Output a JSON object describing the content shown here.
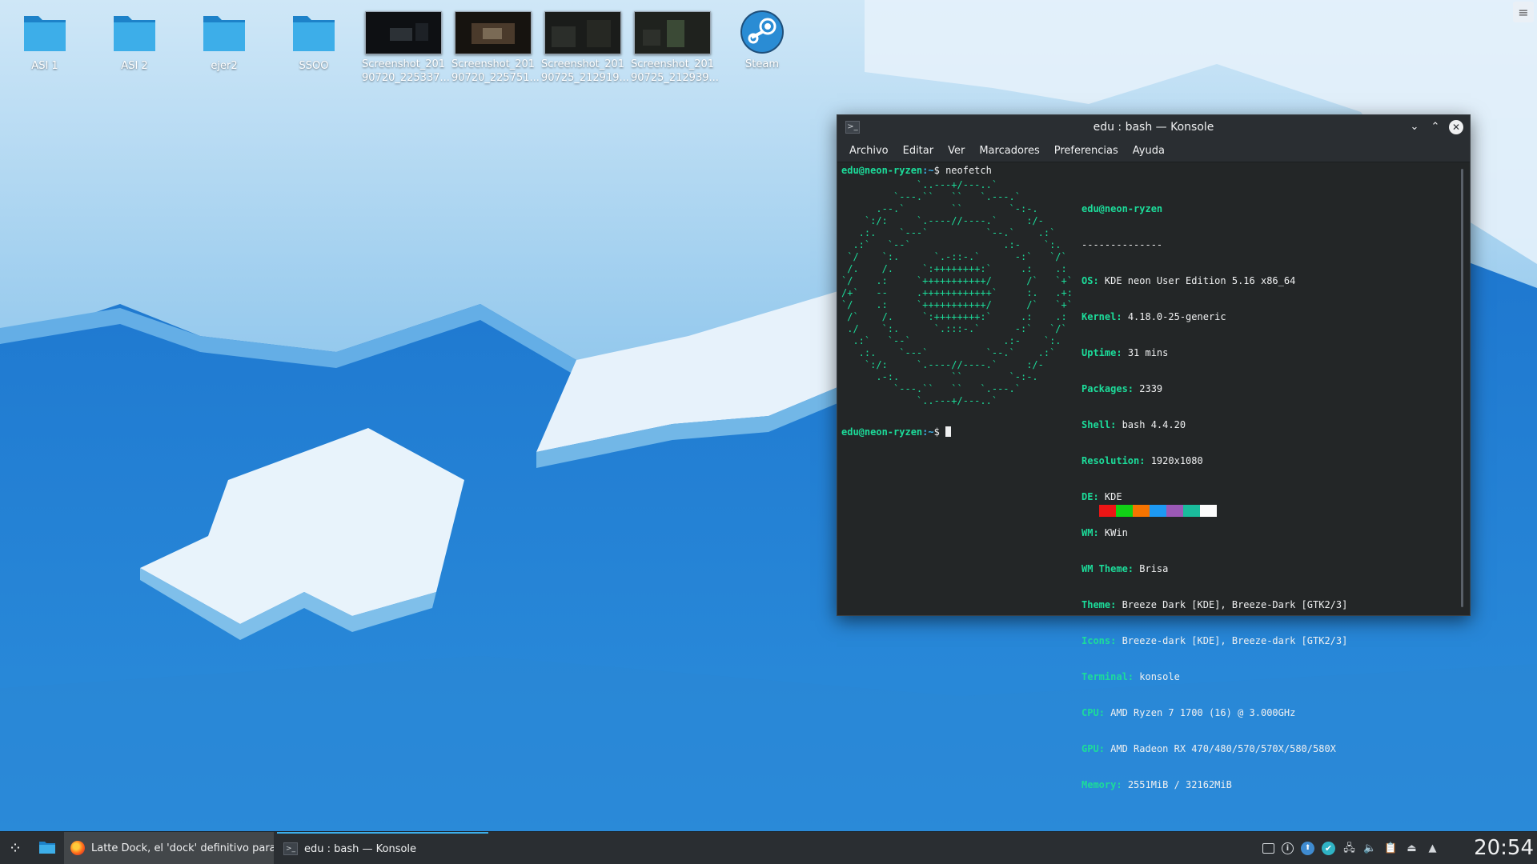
{
  "desktop": {
    "icons": [
      {
        "label": "ASI 1",
        "kind": "folder"
      },
      {
        "label": "ASI 2",
        "kind": "folder"
      },
      {
        "label": "ejer2",
        "kind": "folder"
      },
      {
        "label": "SSOO",
        "kind": "folder"
      },
      {
        "label": "Screenshot_201\n90720_225337...",
        "kind": "image"
      },
      {
        "label": "Screenshot_201\n90720_225751...",
        "kind": "image"
      },
      {
        "label": "Screenshot_201\n90725_212919...",
        "kind": "image"
      },
      {
        "label": "Screenshot_201\n90725_212939...",
        "kind": "image"
      },
      {
        "label": "Steam",
        "kind": "app"
      }
    ],
    "corner_menu_icon": "hamburger-icon",
    "corner_menu_glyph": "≡"
  },
  "konsole": {
    "title": "edu : bash — Konsole",
    "app_icon_glyph": ">_",
    "buttons": {
      "minimize": "⌄",
      "maximize": "⌃",
      "close": "✕"
    },
    "menu": [
      "Archivo",
      "Editar",
      "Ver",
      "Marcadores",
      "Preferencias",
      "Ayuda"
    ],
    "prompt_user": "edu@neon-ryzen",
    "prompt_path": ":~",
    "prompt_symbol": "$ ",
    "command": "neofetch",
    "ascii_art": "             `..---+/---..`\n         `---.``   ``   `.---.`\n      .--.`        ``        `-:-.\n    `:/:     `.----//----.`     :/-\n   .:.    `---`          `--.`    .:`\n  .:`   `--`                .:-    `:.\n `/    `:.      `.-::-.`      -:`   `/`\n /.    /.     `:++++++++:`     .:    .:\n`/    .:     `+++++++++++/      /`   `+`\n/+`   --     .++++++++++++`     :.   .+:\n`/    .:     `+++++++++++/      /`   `+`\n /`    /.     `:++++++++:`     .:    .:\n ./    `:.      `.:::-.`      -:`   `/`\n  .:`   `--`                .:-    `:.\n   .:.    `---`          `--.`    .:`\n    `:/:     `.----//----.`     :/-\n      .-:.         ``        `-:-.\n         `---.``   ``   `.---.`\n             `..---+/---..`",
    "info": {
      "host": "edu@neon-ryzen",
      "separator": "--------------",
      "rows": [
        {
          "key": "OS",
          "value": "KDE neon User Edition 5.16 x86_64"
        },
        {
          "key": "Kernel",
          "value": "4.18.0-25-generic"
        },
        {
          "key": "Uptime",
          "value": "31 mins"
        },
        {
          "key": "Packages",
          "value": "2339"
        },
        {
          "key": "Shell",
          "value": "bash 4.4.20"
        },
        {
          "key": "Resolution",
          "value": "1920x1080"
        },
        {
          "key": "DE",
          "value": "KDE"
        },
        {
          "key": "WM",
          "value": "KWin"
        },
        {
          "key": "WM Theme",
          "value": "Brisa"
        },
        {
          "key": "Theme",
          "value": "Breeze Dark [KDE], Breeze-Dark [GTK2/3]"
        },
        {
          "key": "Icons",
          "value": "Breeze-dark [KDE], Breeze-dark [GTK2/3]"
        },
        {
          "key": "Terminal",
          "value": "konsole"
        },
        {
          "key": "CPU",
          "value": "AMD Ryzen 7 1700 (16) @ 3.000GHz"
        },
        {
          "key": "GPU",
          "value": "AMD Radeon RX 470/480/570/570X/580/580X"
        },
        {
          "key": "Memory",
          "value": "2551MiB / 32162MiB"
        }
      ]
    },
    "palette": [
      "#ed1515",
      "#11d116",
      "#f67400",
      "#1d99f3",
      "#9b59b6",
      "#1abc9c",
      "#fcfcfc"
    ]
  },
  "taskbar": {
    "launcher_glyph": "⁘",
    "tasks": [
      {
        "label": "Latte Dock, el 'dock' definitivo para...",
        "icon": "firefox-icon"
      },
      {
        "label": "edu : bash — Konsole",
        "icon": "konsole-icon"
      }
    ],
    "tray": [
      {
        "icon": "show-desktop-icon",
        "glyph": ""
      },
      {
        "icon": "info-icon",
        "glyph": "i"
      },
      {
        "icon": "updates-icon",
        "glyph": "⬆"
      },
      {
        "icon": "sync-icon",
        "glyph": "✔"
      },
      {
        "icon": "network-icon",
        "glyph": "🖧"
      },
      {
        "icon": "volume-icon",
        "glyph": "🔈"
      },
      {
        "icon": "clipboard-icon",
        "glyph": "📋"
      },
      {
        "icon": "devices-icon",
        "glyph": "⏏"
      },
      {
        "icon": "expand-tray-icon",
        "glyph": "▲"
      }
    ],
    "clock": "20:54"
  }
}
